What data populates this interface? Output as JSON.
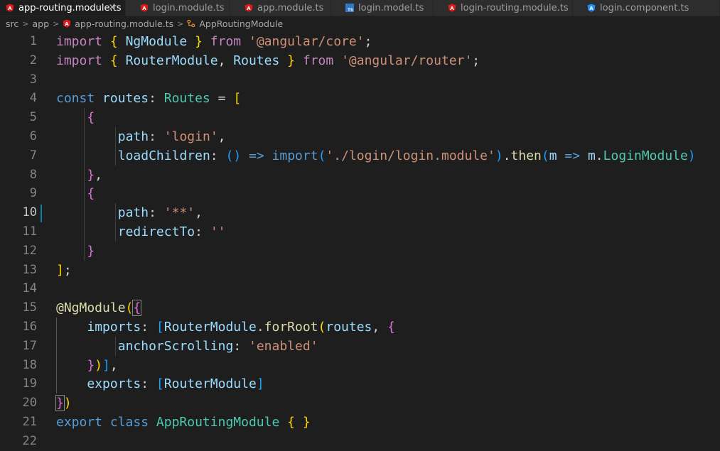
{
  "tabs": [
    {
      "label": "app-routing.module.ts",
      "icon": "angular-icon",
      "active": true,
      "close": "×"
    },
    {
      "label": "login.module.ts",
      "icon": "angular-icon",
      "active": false
    },
    {
      "label": "app.module.ts",
      "icon": "angular-icon",
      "active": false
    },
    {
      "label": "login.model.ts",
      "icon": "typescript-icon",
      "active": false
    },
    {
      "label": "login-routing.module.ts",
      "icon": "angular-icon",
      "active": false
    },
    {
      "label": "login.component.ts",
      "icon": "angular-component-icon",
      "active": false
    }
  ],
  "breadcrumb": {
    "items": [
      "src",
      "app",
      "app-routing.module.ts",
      "AppRoutingModule"
    ],
    "separator": ">"
  },
  "colors": {
    "background": "#1e1e1e",
    "keyword": "#569cd6",
    "control": "#c586c0",
    "type": "#4ec9b0",
    "string": "#ce9178",
    "angular": "#dd1b16"
  },
  "code": {
    "lines": [
      {
        "n": "1",
        "t": "import { NgModule } from '@angular/core';"
      },
      {
        "n": "2",
        "t": "import { RouterModule, Routes } from '@angular/router';"
      },
      {
        "n": "3",
        "t": ""
      },
      {
        "n": "4",
        "t": "const routes: Routes = ["
      },
      {
        "n": "5",
        "t": "    {"
      },
      {
        "n": "6",
        "t": "        path: 'login',"
      },
      {
        "n": "7",
        "t": "        loadChildren: () => import('./login/login.module').then(m => m.LoginModule)"
      },
      {
        "n": "8",
        "t": "    },"
      },
      {
        "n": "9",
        "t": "    {"
      },
      {
        "n": "10",
        "t": "        path: '**',"
      },
      {
        "n": "11",
        "t": "        redirectTo: ''"
      },
      {
        "n": "12",
        "t": "    }"
      },
      {
        "n": "13",
        "t": "];"
      },
      {
        "n": "14",
        "t": ""
      },
      {
        "n": "15",
        "t": "@NgModule({"
      },
      {
        "n": "16",
        "t": "    imports: [RouterModule.forRoot(routes, {"
      },
      {
        "n": "17",
        "t": "        anchorScrolling: 'enabled'"
      },
      {
        "n": "18",
        "t": "    })],"
      },
      {
        "n": "19",
        "t": "    exports: [RouterModule]"
      },
      {
        "n": "20",
        "t": "})"
      },
      {
        "n": "21",
        "t": "export class AppRoutingModule { }"
      },
      {
        "n": "22",
        "t": ""
      }
    ]
  }
}
